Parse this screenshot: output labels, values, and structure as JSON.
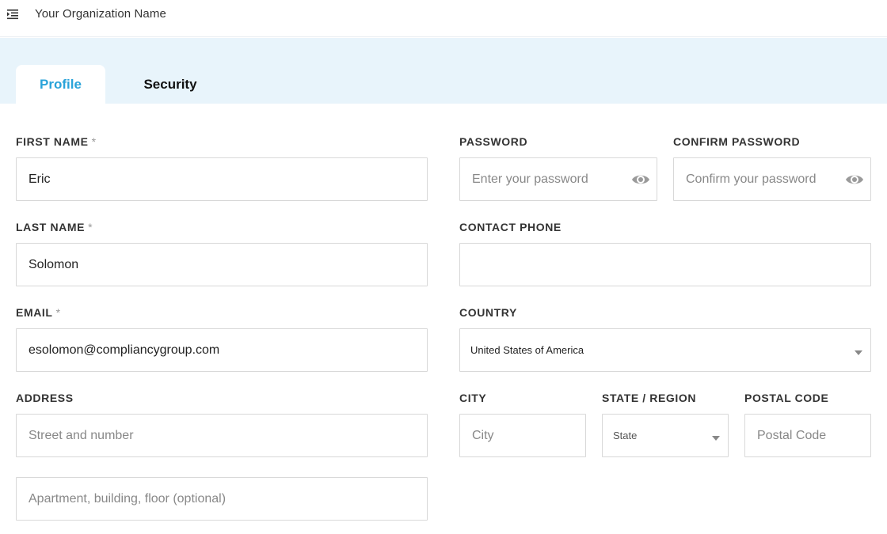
{
  "header": {
    "org_name": "Your Organization Name",
    "menu_icon": "menu-collapse-icon"
  },
  "tabs": [
    {
      "label": "Profile",
      "active": true
    },
    {
      "label": "Security",
      "active": false
    }
  ],
  "colors": {
    "accent": "#29a3d9",
    "tab_bar_bg": "#e8f4fb",
    "border": "#d8d8d8"
  },
  "form": {
    "first_name": {
      "label": "FIRST NAME",
      "required_mark": "*",
      "value": "Eric",
      "placeholder": ""
    },
    "last_name": {
      "label": "LAST NAME",
      "required_mark": "*",
      "value": "Solomon",
      "placeholder": ""
    },
    "email": {
      "label": "EMAIL",
      "required_mark": "*",
      "value": "esolomon@compliancygroup.com",
      "placeholder": ""
    },
    "address": {
      "label": "ADDRESS",
      "line1_placeholder": "Street and number",
      "line2_placeholder": "Apartment, building, floor (optional)"
    },
    "password": {
      "label": "PASSWORD",
      "placeholder": "Enter your password",
      "icon": "eye-icon"
    },
    "confirm_password": {
      "label": "CONFIRM PASSWORD",
      "placeholder": "Confirm your password",
      "icon": "eye-icon"
    },
    "contact_phone": {
      "label": "CONTACT PHONE",
      "value": "",
      "placeholder": ""
    },
    "country": {
      "label": "COUNTRY",
      "selected": "United States of America"
    },
    "city": {
      "label": "CITY",
      "placeholder": "City"
    },
    "state": {
      "label": "STATE / REGION",
      "selected": "State"
    },
    "postal_code": {
      "label": "POSTAL CODE",
      "placeholder": "Postal Code"
    }
  }
}
